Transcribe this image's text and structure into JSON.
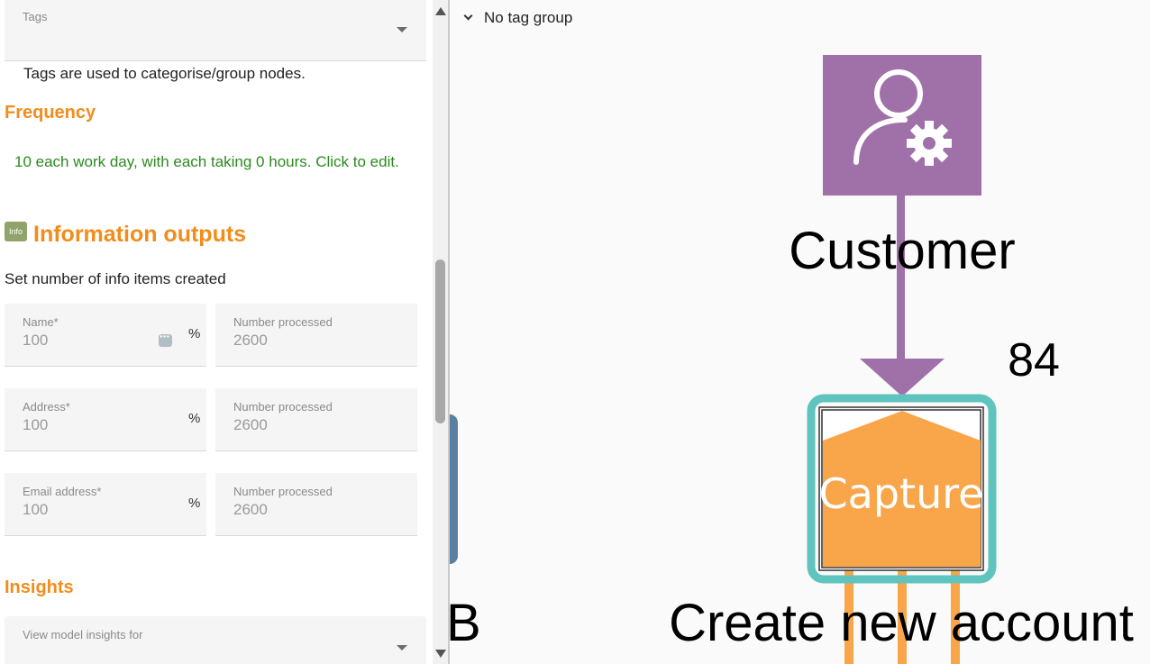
{
  "tags": {
    "label": "Tags",
    "helper": "Tags are used to categorise/group nodes."
  },
  "frequency": {
    "title": "Frequency",
    "text": "10 each work day, with each taking 0 hours. Click to edit."
  },
  "information_outputs": {
    "badge": "Info",
    "title": "Information outputs",
    "subtitle": "Set number of info items created",
    "rows": [
      {
        "name_label": "Name*",
        "name_value": "100",
        "unit": "%",
        "processed_label": "Number processed",
        "processed_value": "2600"
      },
      {
        "name_label": "Address*",
        "name_value": "100",
        "unit": "%",
        "processed_label": "Number processed",
        "processed_value": "2600"
      },
      {
        "name_label": "Email address*",
        "name_value": "100",
        "unit": "%",
        "processed_label": "Number processed",
        "processed_value": "2600"
      }
    ]
  },
  "insights": {
    "title": "Insights",
    "select_label": "View model insights for"
  },
  "canvas": {
    "tag_group": "No tag group",
    "left_edge_label": "B",
    "customer_node": {
      "label": "Customer",
      "icon": "user-gear-icon",
      "color": "#a070a8"
    },
    "flow_count": "84",
    "capture_node": {
      "label": "Capture",
      "caption": "Create new account",
      "fill": "#f9a54a",
      "border": "#5fc4bd"
    }
  }
}
